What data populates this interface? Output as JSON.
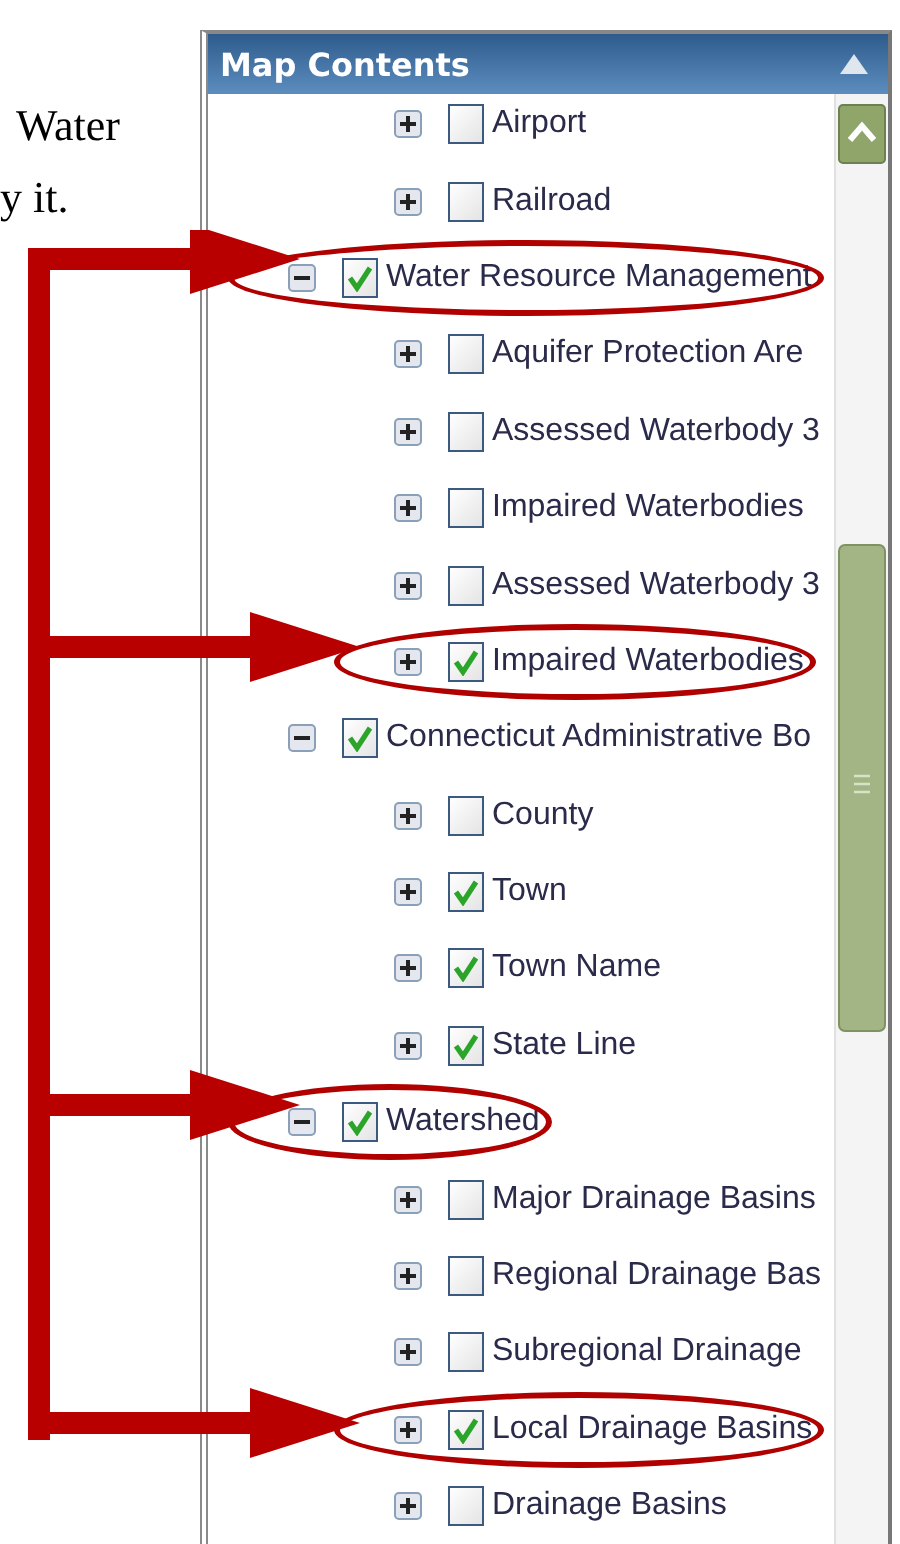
{
  "document_text": [
    "Water",
    "y it."
  ],
  "panel": {
    "title": "Map Contents"
  },
  "tree": [
    {
      "children": [
        {
          "label": "Airport",
          "expanded": false,
          "checked": false,
          "circled": false
        },
        {
          "label": "Railroad",
          "expanded": false,
          "checked": false,
          "circled": false
        }
      ]
    },
    {
      "label": "Water Resource Management",
      "expanded": true,
      "checked": true,
      "circled": true,
      "children": [
        {
          "label": "Aquifer Protection Are",
          "expanded": false,
          "checked": false,
          "circled": false
        },
        {
          "label": "Assessed Waterbody 3",
          "expanded": false,
          "checked": false,
          "circled": false
        },
        {
          "label": "Impaired Waterbodies",
          "expanded": false,
          "checked": false,
          "circled": false
        },
        {
          "label": "Assessed Waterbody 3",
          "expanded": false,
          "checked": false,
          "circled": false
        },
        {
          "label": "Impaired Waterbodies",
          "expanded": false,
          "checked": true,
          "circled": true
        }
      ]
    },
    {
      "label": "Connecticut Administrative Bo",
      "expanded": true,
      "checked": true,
      "circled": false,
      "children": [
        {
          "label": "County",
          "expanded": false,
          "checked": false,
          "circled": false
        },
        {
          "label": "Town",
          "expanded": false,
          "checked": true,
          "circled": false
        },
        {
          "label": "Town Name",
          "expanded": false,
          "checked": true,
          "circled": false
        },
        {
          "label": "State Line",
          "expanded": false,
          "checked": true,
          "circled": false
        }
      ]
    },
    {
      "label": "Watershed",
      "expanded": true,
      "checked": true,
      "circled": true,
      "children": [
        {
          "label": "Major Drainage Basins",
          "expanded": false,
          "checked": false,
          "circled": false
        },
        {
          "label": "Regional Drainage Bas",
          "expanded": false,
          "checked": false,
          "circled": false
        },
        {
          "label": "Subregional Drainage",
          "expanded": false,
          "checked": false,
          "circled": false
        },
        {
          "label": "Local Drainage Basins",
          "expanded": false,
          "checked": true,
          "circled": true
        },
        {
          "label": "Drainage Basins",
          "expanded": false,
          "checked": false,
          "circled": false
        }
      ]
    }
  ]
}
